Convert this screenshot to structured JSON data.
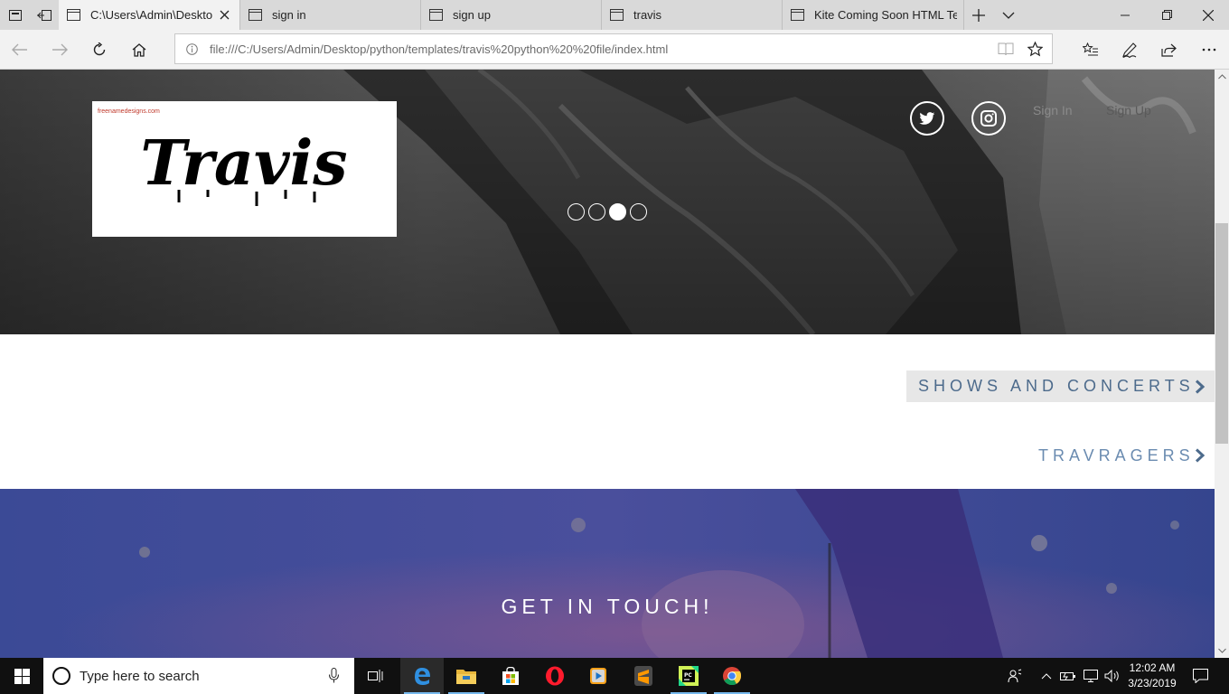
{
  "browser": {
    "tabs": [
      {
        "label": "C:\\Users\\Admin\\Deskto",
        "active": true
      },
      {
        "label": "sign in",
        "active": false
      },
      {
        "label": "sign up",
        "active": false
      },
      {
        "label": "travis",
        "active": false
      },
      {
        "label": "Kite Coming Soon HTML Te",
        "active": false
      }
    ],
    "address": "file:///C:/Users/Admin/Desktop/python/templates/travis%20python%20%20file/index.html",
    "icons": [
      "tab-preview-icon",
      "tabs-aside-icon",
      "back-icon",
      "forward-icon",
      "refresh-icon",
      "home-icon",
      "reading-view-icon",
      "favorite-star-icon",
      "favorites-hub-icon",
      "notes-pen-icon",
      "share-icon",
      "more-icon"
    ]
  },
  "page": {
    "logo": {
      "small_text": "freenamedesigns.com",
      "word": "Travis"
    },
    "nav": {
      "sign_in": "Sign In",
      "sign_up": "Sign Up"
    },
    "carousel": {
      "slides": 4,
      "active_index": 2
    },
    "menu": {
      "shows": "SHOWS AND CONCERTS",
      "travragers": "TRAVRAGERS"
    },
    "contact_title": "GET IN TOUCH!"
  },
  "taskbar": {
    "search_placeholder": "Type here to search",
    "apps": [
      "task-view-icon",
      "edge-icon",
      "file-explorer-icon",
      "store-icon",
      "opera-icon",
      "media-player-icon",
      "sublime-text-icon",
      "pycharm-icon",
      "chrome-icon"
    ],
    "time": "12:02 AM",
    "date": "3/23/2019"
  },
  "colors": {
    "link": "#4d6b8c",
    "contact_bg": "#3c4a92",
    "taskbar": "#101010"
  }
}
